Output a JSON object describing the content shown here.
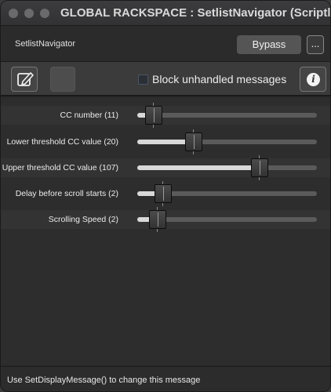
{
  "window": {
    "title": "GLOBAL RACKSPACE : SetlistNavigator (Scriptlet)"
  },
  "header": {
    "script_name": "SetlistNavigator",
    "bypass_label": "Bypass",
    "more_label": "..."
  },
  "toolbar": {
    "edit_icon": "edit-icon",
    "checkbox_label": "Block unhandled messages",
    "checkbox_checked": false,
    "info_glyph": "i",
    "checkbox_color": "#4b5565"
  },
  "parameters": [
    {
      "label": "CC number (11)",
      "value": 0.09
    },
    {
      "label": "Lower threshold CC value (20)",
      "value": 0.315
    },
    {
      "label": "Upper threshold CC value (107)",
      "value": 0.68
    },
    {
      "label": "Delay before scroll starts (2)",
      "value": 0.145
    },
    {
      "label": "Scrolling Speed (2)",
      "value": 0.115
    }
  ],
  "status": {
    "message": "Use SetDisplayMessage() to change this message"
  },
  "colors": {
    "background": "#2d2d2d",
    "track": "#5a5a5a",
    "fill": "#d8d8d8"
  }
}
